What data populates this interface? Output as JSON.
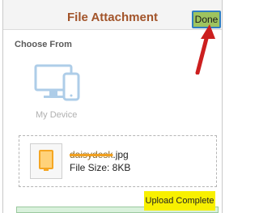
{
  "header": {
    "title": "File Attachment",
    "done_label": "Done"
  },
  "source_section": {
    "heading": "Choose From",
    "device_label": "My Device",
    "device_icon": "device-icon"
  },
  "attachment": {
    "name_suffix": ".jpg",
    "name_redacted": "daisydesk",
    "size_text": "File Size: 8KB",
    "thumb_icon": "image-file-icon"
  },
  "upload": {
    "status_text": "Upload Complete",
    "progress": 1.0
  },
  "colors": {
    "title": "#a2542a",
    "done_bg": "#9ec45f",
    "done_border": "#2f7fc3",
    "status_highlight": "#f8f000",
    "arrow": "#cc1f1f"
  }
}
